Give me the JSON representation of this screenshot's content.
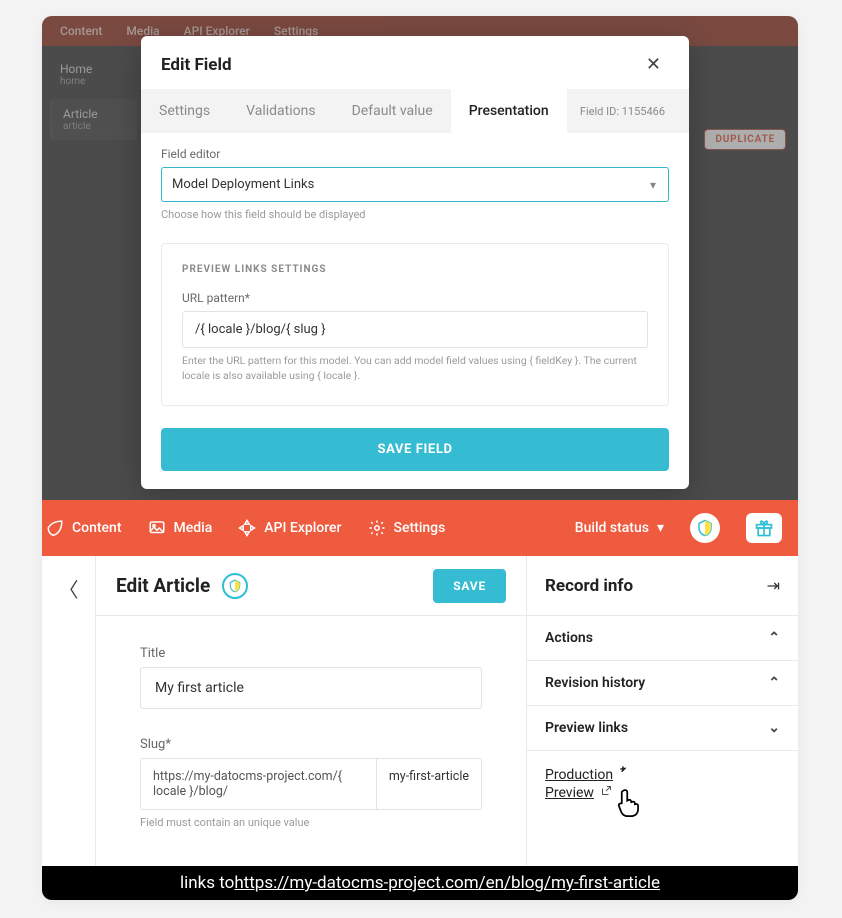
{
  "bg": {
    "header": [
      "Content",
      "Media",
      "API Explorer",
      "Settings"
    ],
    "sidebar": [
      {
        "name": "Home",
        "sub": "home"
      },
      {
        "name": "Article",
        "sub": "article"
      }
    ],
    "duplicate": "DUPLICATE"
  },
  "modal": {
    "title": "Edit Field",
    "tabs": [
      "Settings",
      "Validations",
      "Default value",
      "Presentation"
    ],
    "active_tab": "Presentation",
    "field_id_label": "Field ID: 1155466",
    "field_editor_label": "Field editor",
    "field_editor_value": "Model Deployment Links",
    "field_editor_help": "Choose how this field should be displayed",
    "settings_title": "PREVIEW LINKS SETTINGS",
    "url_pattern_label": "URL pattern*",
    "url_pattern_value": "/{ locale }/blog/{ slug }",
    "url_pattern_help": "Enter the URL pattern for this model. You can add model field values using { fieldKey }. The current locale is also available using { locale }.",
    "save_label": "SAVE FIELD"
  },
  "topbar": {
    "items": [
      "Content",
      "Media",
      "API Explorer",
      "Settings"
    ],
    "build_status": "Build status"
  },
  "editor": {
    "title": "Edit Article",
    "save_label": "SAVE",
    "title_label": "Title",
    "title_value": "My first article",
    "slug_label": "Slug*",
    "slug_prefix": "https://my-datocms-project.com/{ locale }/blog/",
    "slug_value": "my-first-article",
    "slug_help": "Field must contain an unique value",
    "record_info": "Record info",
    "accordion": [
      "Actions",
      "Revision history",
      "Preview links"
    ],
    "preview_links": {
      "production": "Production",
      "preview": "Preview"
    }
  },
  "footer": {
    "prefix": "links to ",
    "url": "https://my-datocms-project.com/en/blog/my-first-article"
  }
}
